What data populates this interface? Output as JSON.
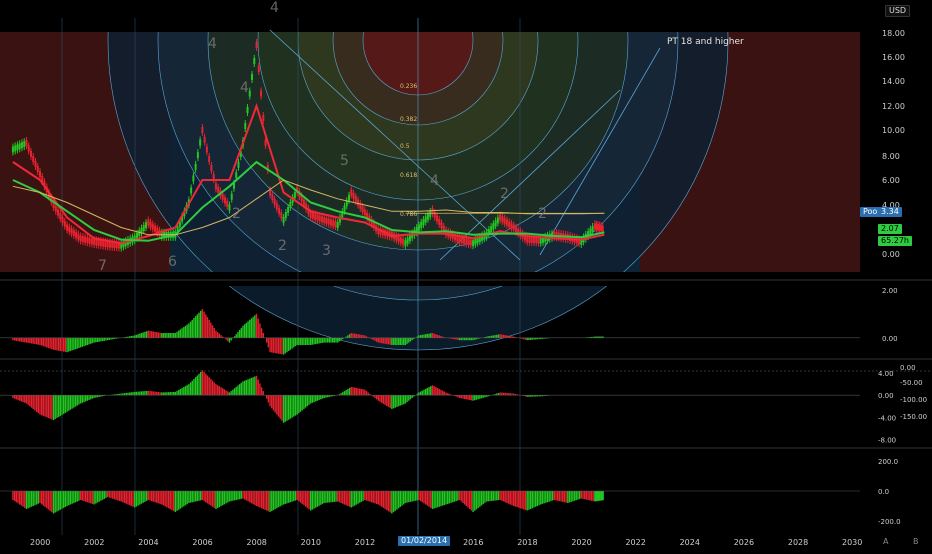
{
  "currency": "USD",
  "annotation": "PT 18 and higher",
  "cursor_date": "01/02/2014",
  "labels": {
    "pool": "Pool",
    "pool_value": "3.34",
    "price_value": "2.07",
    "time_value": "65.27h"
  },
  "fib_levels": [
    "0.236",
    "0.382",
    "0.5",
    "0.618",
    "0.786"
  ],
  "corner_labels": [
    "A",
    "B"
  ],
  "colors": {
    "background": "#000000",
    "bull": "#22c722",
    "bear": "#e8222f",
    "ma_fast": "#f02838",
    "ma_slow": "#2ecc40",
    "ma_long": "#d4b860",
    "zone_red": "#3a1212",
    "zone_blue": "#0e2436",
    "fib_line": "#5aa8d8"
  },
  "chart_data": [
    {
      "type": "line",
      "pane": "price",
      "y_scale": "log",
      "ylim": [
        0.0,
        18.0
      ],
      "x_range": [
        1999,
        2031
      ],
      "x_ticks": [
        "2000",
        "2002",
        "2004",
        "2006",
        "2008",
        "2010",
        "2012",
        "2014",
        "2016",
        "2018",
        "2020",
        "2022",
        "2024",
        "2026",
        "2028",
        "2030"
      ],
      "y_ticks": [
        "18.00",
        "16.00",
        "14.00",
        "12.00",
        "10.00",
        "8.00",
        "6.00",
        "4.00",
        "2.00",
        "0.00"
      ],
      "wave_labels": [
        "4",
        "4",
        "4",
        "2",
        "2",
        "3",
        "5",
        "4",
        "2",
        "2",
        "6",
        "7"
      ],
      "series": [
        {
          "x": [
            1999.0,
            1999.5,
            2000.0,
            2000.5,
            2001.0,
            2001.5,
            2002.0,
            2002.5,
            2003.0,
            2003.5,
            2004.0,
            2004.5,
            2005.0,
            2005.5,
            2006.0,
            2006.5,
            2007.0,
            2007.5,
            2008.0,
            2008.5,
            2009.0,
            2009.5,
            2010.0,
            2010.5,
            2011.0,
            2011.5,
            2012.0,
            2012.5,
            2013.0,
            2013.5,
            2014.0,
            2014.5,
            2015.0,
            2015.5,
            2016.0,
            2016.5,
            2017.0,
            2017.5,
            2018.0,
            2018.5,
            2019.0,
            2019.5,
            2020.0,
            2020.5,
            2020.85
          ],
          "y": [
            8.5,
            9.0,
            6.5,
            4.0,
            2.2,
            1.3,
            1.0,
            0.8,
            0.7,
            1.3,
            2.6,
            1.6,
            1.6,
            4.2,
            10.0,
            5.5,
            3.8,
            9.0,
            17.0,
            5.0,
            2.8,
            5.2,
            3.2,
            2.8,
            2.4,
            5.0,
            3.4,
            1.9,
            1.6,
            0.9,
            2.2,
            3.5,
            1.8,
            1.2,
            0.9,
            1.6,
            3.0,
            2.2,
            1.2,
            1.1,
            1.6,
            1.4,
            1.0,
            2.3,
            2.07
          ]
        },
        {
          "x": [
            1999.0,
            2000.0,
            2001.0,
            2002.0,
            2003.0,
            2004.0,
            2005.0,
            2006.0,
            2007.0,
            2008.0,
            2009.0,
            2010.0,
            2011.0,
            2012.0,
            2013.0,
            2014.0,
            2015.0,
            2016.0,
            2017.0,
            2018.0,
            2019.0,
            2020.0,
            2020.85
          ],
          "y": [
            7.5,
            6.0,
            3.0,
            1.3,
            0.9,
            1.5,
            2.2,
            6.0,
            6.0,
            12.0,
            5.0,
            3.5,
            3.0,
            2.6,
            1.5,
            1.7,
            1.7,
            1.3,
            1.9,
            1.5,
            1.3,
            1.2,
            1.6
          ]
        },
        {
          "x": [
            1999.0,
            2000.0,
            2001.0,
            2002.0,
            2003.0,
            2004.0,
            2005.0,
            2006.0,
            2007.0,
            2008.0,
            2009.0,
            2010.0,
            2011.0,
            2012.0,
            2013.0,
            2014.0,
            2015.0,
            2016.0,
            2017.0,
            2018.0,
            2019.0,
            2020.0,
            2020.85
          ],
          "y": [
            6.0,
            5.0,
            3.5,
            2.0,
            1.2,
            1.1,
            1.6,
            3.8,
            5.5,
            7.5,
            6.0,
            4.2,
            3.5,
            3.0,
            2.0,
            1.8,
            1.9,
            1.6,
            1.7,
            1.7,
            1.5,
            1.4,
            1.8
          ]
        },
        {
          "x": [
            1999.0,
            2000.0,
            2001.0,
            2002.0,
            2003.0,
            2004.0,
            2005.0,
            2006.0,
            2007.0,
            2008.0,
            2009.0,
            2010.0,
            2011.0,
            2012.0,
            2013.0,
            2014.0,
            2015.0,
            2016.0,
            2017.0,
            2018.0,
            2019.0,
            2020.0,
            2020.85
          ],
          "y": [
            5.5,
            5.0,
            4.2,
            3.2,
            2.2,
            1.6,
            1.6,
            2.2,
            3.0,
            4.5,
            6.0,
            5.2,
            4.5,
            4.0,
            3.5,
            3.5,
            3.6,
            3.4,
            3.4,
            3.3,
            3.3,
            3.3,
            3.34
          ]
        }
      ]
    },
    {
      "type": "bar",
      "pane": "oscillator-1",
      "ylim": [
        -0.8,
        2.2
      ],
      "y_ticks": [
        "2.00",
        "0.00"
      ],
      "series": [
        {
          "x": [
            1999,
            1999.5,
            2000,
            2000.5,
            2001,
            2001.5,
            2002,
            2002.5,
            2003,
            2003.5,
            2004,
            2004.5,
            2005,
            2005.5,
            2006,
            2006.5,
            2007,
            2007.5,
            2008,
            2008.5,
            2009,
            2009.5,
            2010,
            2010.5,
            2011,
            2011.5,
            2012,
            2012.5,
            2013,
            2013.5,
            2014,
            2014.5,
            2015,
            2015.5,
            2016,
            2016.5,
            2017,
            2017.5,
            2018,
            2018.5,
            2019,
            2019.5,
            2020,
            2020.5,
            2020.85
          ],
          "values": [
            -0.1,
            -0.2,
            -0.3,
            -0.5,
            -0.6,
            -0.4,
            -0.2,
            -0.1,
            0.0,
            0.1,
            0.3,
            0.2,
            0.2,
            0.6,
            1.2,
            0.3,
            -0.2,
            0.5,
            1.0,
            -0.6,
            -0.7,
            -0.3,
            -0.3,
            -0.2,
            -0.2,
            0.2,
            0.1,
            -0.2,
            -0.3,
            -0.3,
            0.1,
            0.2,
            0.0,
            -0.1,
            -0.1,
            0.05,
            0.15,
            0.05,
            -0.1,
            -0.05,
            0.0,
            0.0,
            0.0,
            0.05,
            0.05
          ]
        }
      ]
    },
    {
      "type": "bar",
      "pane": "oscillator-2",
      "ylim": [
        -9.0,
        6.0
      ],
      "y_ticks": [
        "4.00",
        "0.00",
        "-4.00",
        "-8.00"
      ],
      "y_ticks_right": [
        "0.00",
        "-50.00",
        "-100.00",
        "-150.00"
      ],
      "series": [
        {
          "x": [
            1999,
            1999.5,
            2000,
            2000.5,
            2001,
            2001.5,
            2002,
            2002.5,
            2003,
            2003.5,
            2004,
            2004.5,
            2005,
            2005.5,
            2006,
            2006.5,
            2007,
            2007.5,
            2008,
            2008.5,
            2009,
            2009.5,
            2010,
            2010.5,
            2011,
            2011.5,
            2012,
            2012.5,
            2013,
            2013.5,
            2014,
            2014.5,
            2015,
            2015.5,
            2016,
            2016.5,
            2017,
            2017.5,
            2018,
            2018.5,
            2019,
            2019.5,
            2020,
            2020.5,
            2020.85
          ],
          "values": [
            -0.5,
            -1.5,
            -3.5,
            -4.5,
            -3.0,
            -1.5,
            -0.5,
            0.0,
            0.3,
            0.6,
            0.8,
            0.5,
            0.6,
            2.0,
            4.5,
            2.0,
            0.5,
            2.5,
            3.5,
            -2.0,
            -5.0,
            -3.5,
            -1.5,
            -0.5,
            0.0,
            1.5,
            1.0,
            -1.0,
            -2.5,
            -1.5,
            0.5,
            1.8,
            0.5,
            -0.5,
            -1.0,
            -0.3,
            0.5,
            0.3,
            -0.3,
            -0.2,
            0.0,
            0.0,
            0.0,
            0.0,
            0.0
          ]
        }
      ]
    },
    {
      "type": "bar",
      "pane": "oscillator-3",
      "ylim": [
        -260.0,
        260.0
      ],
      "y_ticks": [
        "200.0",
        "0.0",
        "-200.0"
      ],
      "series": [
        {
          "x": [
            1999,
            1999.5,
            2000,
            2000.5,
            2001,
            2001.5,
            2002,
            2002.5,
            2003,
            2003.5,
            2004,
            2004.5,
            2005,
            2005.5,
            2006,
            2006.5,
            2007,
            2007.5,
            2008,
            2008.5,
            2009,
            2009.5,
            2010,
            2010.5,
            2011,
            2011.5,
            2012,
            2012.5,
            2013,
            2013.5,
            2014,
            2014.5,
            2015,
            2015.5,
            2016,
            2016.5,
            2017,
            2017.5,
            2018,
            2018.5,
            2019,
            2019.5,
            2020,
            2020.5,
            2020.85
          ],
          "values": [
            -60,
            -120,
            -80,
            -150,
            -100,
            -60,
            -90,
            -40,
            -70,
            -110,
            -60,
            -90,
            -140,
            -80,
            -60,
            -120,
            -70,
            -50,
            -100,
            -140,
            -90,
            -60,
            -130,
            -80,
            -70,
            -110,
            -60,
            -90,
            -150,
            -80,
            -60,
            -120,
            -90,
            -60,
            -140,
            -70,
            -60,
            -100,
            -130,
            -90,
            -60,
            -80,
            -50,
            -70,
            -60
          ]
        }
      ]
    }
  ]
}
